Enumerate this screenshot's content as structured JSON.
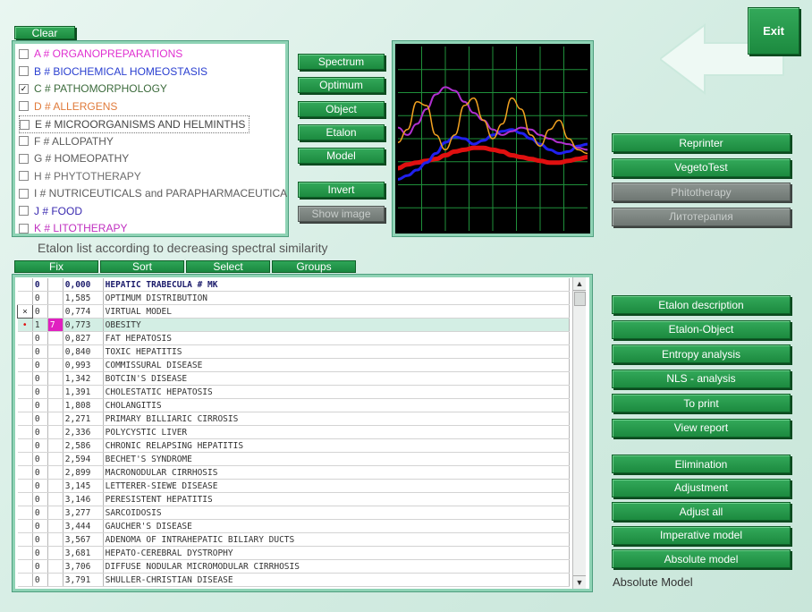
{
  "top": {
    "clear_label": "Clear",
    "exit_label": "Exit",
    "list_caption": "Etalon list according to decreasing spectral similarity",
    "bottom_status": "Absolute Model"
  },
  "categories": [
    {
      "label": "A # ORGANOPREPARATIONS",
      "color": "#e030d0",
      "checked": false
    },
    {
      "label": "B # BIOCHEMICAL HOMEOSTASIS",
      "color": "#2a3fd0",
      "checked": false
    },
    {
      "label": "C # PATHOMORPHOLOGY",
      "color": "#3c6b3c",
      "checked": true
    },
    {
      "label": "D # ALLERGENS",
      "color": "#e07a3a",
      "checked": false
    },
    {
      "label": "E # MICROORGANISMS AND HELMINTHS",
      "color": "#444444",
      "checked": false
    },
    {
      "label": "F # ALLOPATHY",
      "color": "#5c5c5c",
      "checked": false
    },
    {
      "label": "G # HOMEOPATHY",
      "color": "#5c5c5c",
      "checked": false
    },
    {
      "label": "H # PHYTOTHERAPY",
      "color": "#6e6e6e",
      "checked": false
    },
    {
      "label": "I # NUTRICEUTICALS and PARAPHARMACEUTICA",
      "color": "#5c5c5c",
      "checked": false
    },
    {
      "label": "J # FOOD",
      "color": "#3a2ab0",
      "checked": false
    },
    {
      "label": "K # LITOTHERAPY",
      "color": "#c030c0",
      "checked": false
    }
  ],
  "mid_buttons": [
    "Spectrum",
    "Optimum",
    "Object",
    "Etalon",
    "Model",
    "Invert",
    "Show image"
  ],
  "right_buttons_top": [
    {
      "label": "Reprinter",
      "enabled": true
    },
    {
      "label": "VegetoTest",
      "enabled": true
    },
    {
      "label": "Phitotherapy",
      "enabled": false
    },
    {
      "label": "Литотерапия",
      "enabled": false
    }
  ],
  "right_buttons_mid": [
    "Etalon description",
    "Etalon-Object",
    "Entropy analysis",
    "NLS - analysis",
    "To print",
    "View report"
  ],
  "right_buttons_bottom": [
    "Elimination",
    "Adjustment",
    "Adjust all",
    "Imperative model",
    "Absolute model"
  ],
  "list_headers": [
    "Fix",
    "Sort",
    "Select",
    "Groups"
  ],
  "rows": [
    {
      "mark": "",
      "n": "0",
      "tag": "",
      "value": "0,000",
      "name": "HEPATIC TRABECULA # MK"
    },
    {
      "mark": "",
      "n": "0",
      "tag": "",
      "value": "1,585",
      "name": "OPTIMUM DISTRIBUTION"
    },
    {
      "mark": "×",
      "n": "0",
      "tag": "",
      "value": "0,774",
      "name": "VIRTUAL MODEL"
    },
    {
      "mark": "•",
      "n": "1",
      "tag": "7",
      "value": "0,773",
      "name": "OBESITY"
    },
    {
      "mark": "",
      "n": "0",
      "tag": "",
      "value": "0,827",
      "name": "FAT HEPATOSIS"
    },
    {
      "mark": "",
      "n": "0",
      "tag": "",
      "value": "0,840",
      "name": "TOXIC HEPATITIS"
    },
    {
      "mark": "",
      "n": "0",
      "tag": "",
      "value": "0,993",
      "name": "COMMISSURAL DISEASE"
    },
    {
      "mark": "",
      "n": "0",
      "tag": "",
      "value": "1,342",
      "name": "BOTCIN'S DISEASE"
    },
    {
      "mark": "",
      "n": "0",
      "tag": "",
      "value": "1,391",
      "name": "CHOLESTATIC HEPATOSIS"
    },
    {
      "mark": "",
      "n": "0",
      "tag": "",
      "value": "1,808",
      "name": "CHOLANGITIS"
    },
    {
      "mark": "",
      "n": "0",
      "tag": "",
      "value": "2,271",
      "name": "PRIMARY BILLIARIC CIRROSIS"
    },
    {
      "mark": "",
      "n": "0",
      "tag": "",
      "value": "2,336",
      "name": "POLYCYSTIC LIVER"
    },
    {
      "mark": "",
      "n": "0",
      "tag": "",
      "value": "2,586",
      "name": "CHRONIC RELAPSING HEPATITIS"
    },
    {
      "mark": "",
      "n": "0",
      "tag": "",
      "value": "2,594",
      "name": "BECHET'S SYNDROME"
    },
    {
      "mark": "",
      "n": "0",
      "tag": "",
      "value": "2,899",
      "name": "MACRONODULAR CIRRHOSIS"
    },
    {
      "mark": "",
      "n": "0",
      "tag": "",
      "value": "3,145",
      "name": "LETTERER-SIEWE DISEASE"
    },
    {
      "mark": "",
      "n": "0",
      "tag": "",
      "value": "3,146",
      "name": "PERESISTENT HEPATITIS"
    },
    {
      "mark": "",
      "n": "0",
      "tag": "",
      "value": "3,277",
      "name": "SARCOIDOSIS"
    },
    {
      "mark": "",
      "n": "0",
      "tag": "",
      "value": "3,444",
      "name": "GAUCHER'S DISEASE"
    },
    {
      "mark": "",
      "n": "0",
      "tag": "",
      "value": "3,567",
      "name": "ADENOMA OF INTRAHEPATIC BILIARY DUCTS"
    },
    {
      "mark": "",
      "n": "0",
      "tag": "",
      "value": "3,681",
      "name": "HEPATO-CEREBRAL DYSTROPHY"
    },
    {
      "mark": "",
      "n": "0",
      "tag": "",
      "value": "3,706",
      "name": "DIFFUSE NODULAR MICROMODULAR CIRRHOSIS"
    },
    {
      "mark": "",
      "n": "0",
      "tag": "",
      "value": "3,791",
      "name": "SHULLER-CHRISTIAN DISEASE"
    }
  ],
  "selected_row": 3,
  "chart_data": {
    "type": "line",
    "grid": true,
    "background": "#000000",
    "grid_color": "#1f8f3a",
    "x": [
      0,
      1,
      2,
      3,
      4,
      5,
      6,
      7,
      8,
      9,
      10,
      11,
      12,
      13,
      14,
      15,
      16,
      17,
      18,
      19,
      20
    ],
    "series": [
      {
        "color": "#e01010",
        "values": [
          0.34,
          0.36,
          0.37,
          0.38,
          0.39,
          0.41,
          0.43,
          0.44,
          0.45,
          0.45,
          0.44,
          0.43,
          0.41,
          0.4,
          0.39,
          0.38,
          0.37,
          0.37,
          0.38,
          0.39,
          0.4
        ]
      },
      {
        "color": "#2020ee",
        "values": [
          0.28,
          0.3,
          0.33,
          0.37,
          0.42,
          0.48,
          0.51,
          0.5,
          0.47,
          0.49,
          0.52,
          0.54,
          0.55,
          0.53,
          0.5,
          0.47,
          0.44,
          0.42,
          0.43,
          0.46,
          0.47
        ]
      },
      {
        "color": "#b030d0",
        "values": [
          0.56,
          0.52,
          0.58,
          0.66,
          0.74,
          0.78,
          0.76,
          0.7,
          0.64,
          0.6,
          0.55,
          0.52,
          0.54,
          0.56,
          0.55,
          0.52,
          0.5,
          0.48,
          0.47,
          0.45,
          0.44
        ]
      },
      {
        "color": "#f0a020",
        "values": [
          0.48,
          0.55,
          0.7,
          0.68,
          0.52,
          0.44,
          0.52,
          0.68,
          0.72,
          0.6,
          0.5,
          0.58,
          0.72,
          0.66,
          0.52,
          0.46,
          0.55,
          0.6,
          0.5,
          0.44,
          0.42
        ]
      }
    ],
    "ylim": [
      0,
      1
    ]
  }
}
